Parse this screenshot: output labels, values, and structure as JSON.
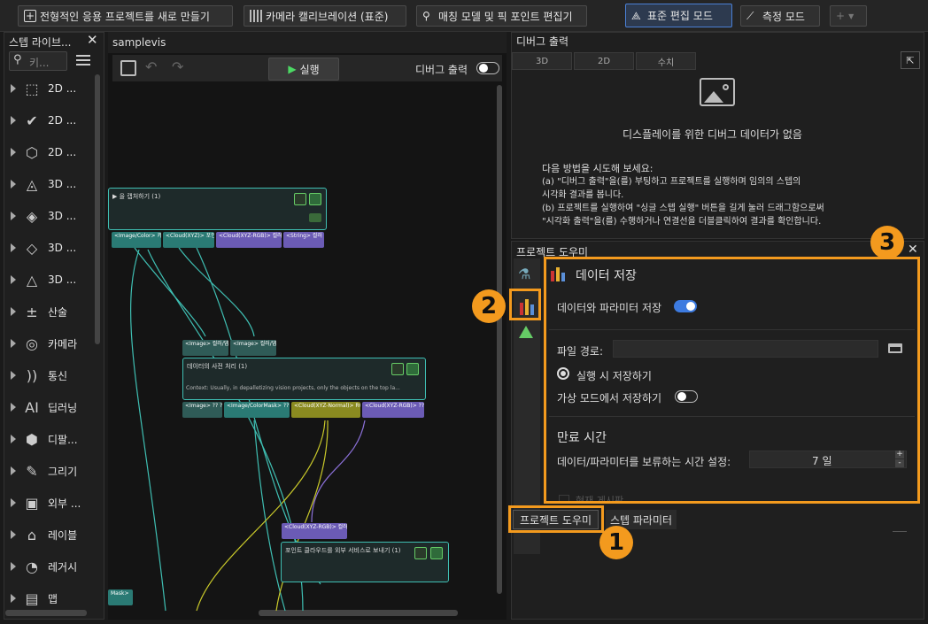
{
  "toolbar": {
    "new_project": "전형적인 응용 프로젝트를 새로 만들기",
    "camera_calib": "카메라 캘리브레이션 (표준)",
    "matching": "매칭 모델 및 픽 포인트 편집기",
    "standard_mode": "표준 편집 모드",
    "measure_mode": "측정 모드",
    "plus": "+"
  },
  "library": {
    "title": "스텝 라이브...",
    "search_placeholder": "키...",
    "items": [
      {
        "label": "2D ...",
        "icon": "2d-roi-icon"
      },
      {
        "label": "2D ...",
        "icon": "2d-check-icon"
      },
      {
        "label": "2D ...",
        "icon": "2d-hex-icon"
      },
      {
        "label": "3D ...",
        "icon": "3d-pyramid-icon"
      },
      {
        "label": "3D ...",
        "icon": "3d-layer-icon"
      },
      {
        "label": "3D ...",
        "icon": "3d-cube-icon"
      },
      {
        "label": "3D ...",
        "icon": "3d-tri-icon"
      },
      {
        "label": "산술",
        "icon": "math-icon"
      },
      {
        "label": "카메라",
        "icon": "camera-icon"
      },
      {
        "label": "통신",
        "icon": "comm-icon"
      },
      {
        "label": "딥러닝",
        "icon": "ai-icon"
      },
      {
        "label": "디팔...",
        "icon": "boxes-icon"
      },
      {
        "label": "그리기",
        "icon": "pen-icon"
      },
      {
        "label": "외부 ...",
        "icon": "external-icon"
      },
      {
        "label": "레이블",
        "icon": "tag-icon"
      },
      {
        "label": "레거시",
        "icon": "legacy-icon"
      },
      {
        "label": "맵",
        "icon": "map-icon"
      }
    ]
  },
  "canvas": {
    "tab": "samplevis",
    "run": "실행",
    "debug_output": "디버그 출력",
    "node1": {
      "title": "▶ 을 캡처하기 (1)",
      "ports": [
        "<Image/Color>\n카메라 컬러 맵",
        "<Cloud(XYZ)>\n포인트 클라우드",
        "<Cloud(XYZ-RGB)>\n컬러 포인트 클라우드",
        "<String>\n컬러 맵 경로"
      ]
    },
    "node2": {
      "title": "데이터의 사전 처리 (1)",
      "inputs": [
        "<Image>\n컬러/뎁스 맵",
        "<Image>\n컬러/뎁스 맵"
      ],
      "context": "Context: Usually, in depalletizing vision projects, only the objects on the top la...",
      "ports": [
        "<Image>\n?? ??? ???",
        "<Image/ColorMask>\n?? ?? ???",
        "<Cloud(XYZ-Normal)>\nROI?? ??? ????",
        "<Cloud(XYZ-RGB)>\n??? ?? ???"
      ]
    },
    "node3": {
      "input": "<Cloud(XYZ-RGB)>\n컬러 포인트 클라우드",
      "title": "포인트 클라우드를 외부 서비스로 보내기 (1)"
    },
    "mask_port": "Mask>"
  },
  "debug": {
    "title": "디버그 출력",
    "tabs": [
      "3D",
      "2D",
      "수치"
    ],
    "no_data": "디스플레이를 위한 디버그 데이터가 없음",
    "hint_title": "다음 방법을 시도해 보세요:",
    "hint_lines": [
      "(a) \"디버그 출력\"을(를) 부팅하고 프로젝트를 실행하며 임의의 스텝의",
      "시각화 결과를 봅니다.",
      "(b) 프로젝트를 실행하여 \"싱글 스텝 실행\" 버튼을 길게 눌러 드래그함으로써",
      "\"시각화 출력\"을(를) 수행하거나 연결선을 더블클릭하여 결과를 확인합니다."
    ]
  },
  "assistant": {
    "title": "프로젝트 도우미",
    "section_title": "데이터 저장",
    "save_toggle_label": "데이터와 파라미터 저장",
    "file_path_label": "파일 경로:",
    "radio_label": "실행 시 저장하기",
    "virtual_label": "가상 모드에서 저장하기",
    "expire_title": "만료 시간",
    "keep_label": "데이터/파라미터를 보류하는 시간 설정:",
    "keep_value": "7 일",
    "cutoff_label": "현재 게시판",
    "tab_assistant": "프로젝트 도우미",
    "tab_params": "스텝 파라미터"
  },
  "badges": [
    "1",
    "2",
    "3"
  ],
  "colors": {
    "accent": "#f39a1e",
    "node_border": "#3fbfb3",
    "toggle_on": "#3d7be0"
  }
}
